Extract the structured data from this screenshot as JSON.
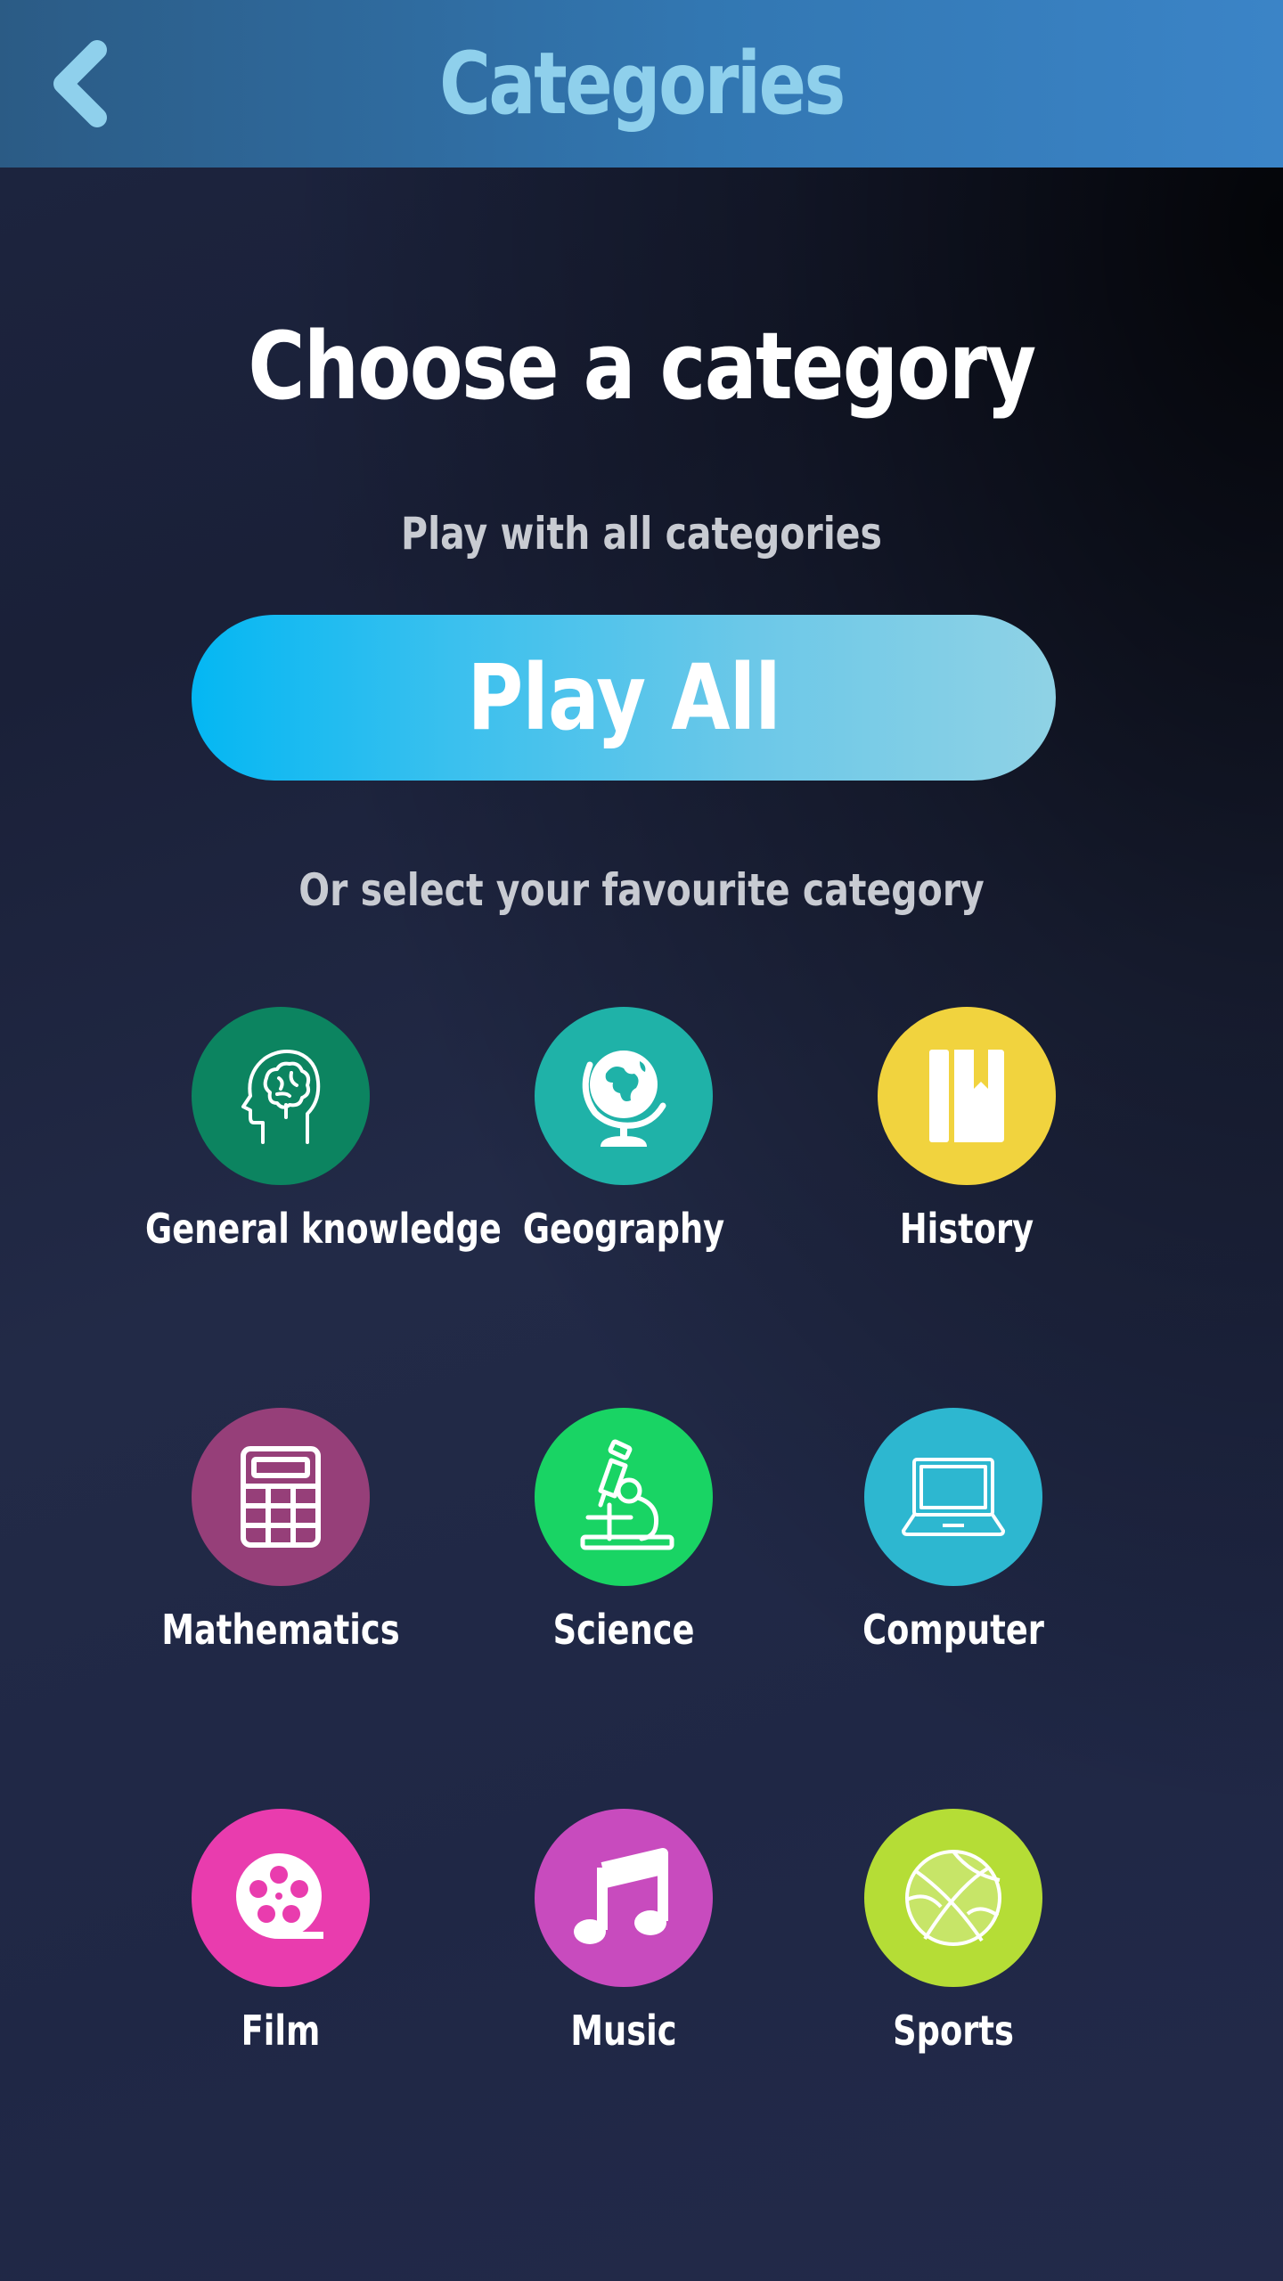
{
  "header": {
    "title": "Categories",
    "back_icon": "chevron-left-icon",
    "accent_color": "#8fd0ec"
  },
  "main": {
    "heading": "Choose a category",
    "play_all_caption": "Play with all categories",
    "play_all_label": "Play All",
    "select_caption": "Or select your favourite category"
  },
  "categories": [
    {
      "label": "General knowledge",
      "icon": "brain-head-icon",
      "color": "#0c8460"
    },
    {
      "label": "Geography",
      "icon": "globe-icon",
      "color": "#1fb2a8"
    },
    {
      "label": "History",
      "icon": "book-icon",
      "color": "#f1d33e"
    },
    {
      "label": "Mathematics",
      "icon": "calculator-icon",
      "color": "#963f79"
    },
    {
      "label": "Science",
      "icon": "microscope-icon",
      "color": "#19d464"
    },
    {
      "label": "Computer",
      "icon": "laptop-icon",
      "color": "#2db7d0"
    },
    {
      "label": "Film",
      "icon": "film-reel-icon",
      "color": "#e93cae"
    },
    {
      "label": "Music",
      "icon": "music-note-icon",
      "color": "#c84bbe"
    },
    {
      "label": "Sports",
      "icon": "basketball-icon",
      "color": "#b5dd36"
    }
  ]
}
